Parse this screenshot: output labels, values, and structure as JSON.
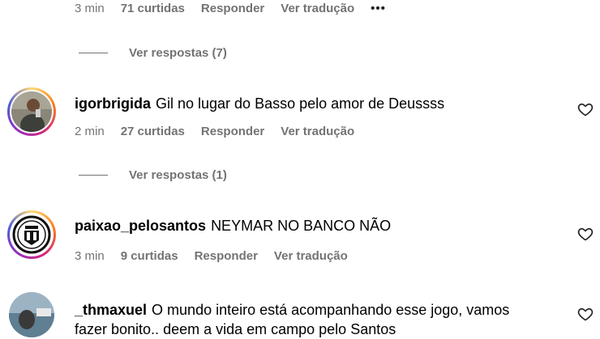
{
  "top_comment": {
    "time": "3 min",
    "likes": "71 curtidas",
    "reply_label": "Responder",
    "translate_label": "Ver tradução",
    "more_label": "•••",
    "view_replies": "Ver respostas (7)"
  },
  "comments": [
    {
      "username": "igorbrigida",
      "text": "Gil no lugar do Basso pelo amor de Deussss",
      "time": "2 min",
      "likes": "27 curtidas",
      "reply_label": "Responder",
      "translate_label": "Ver tradução",
      "view_replies": "Ver respostas (1)"
    },
    {
      "username": "paixao_pelosantos",
      "text": "NEYMAR NO BANCO NÃO",
      "time": "3 min",
      "likes": "9 curtidas",
      "reply_label": "Responder",
      "translate_label": "Ver tradução"
    },
    {
      "username": "_thmaxuel",
      "text": "O mundo inteiro está acompanhando esse jogo, vamos fazer bonito.. deem a vida em campo pelo Santos"
    }
  ],
  "icons": {
    "heart": "heart-icon",
    "more": "more-options-icon"
  }
}
